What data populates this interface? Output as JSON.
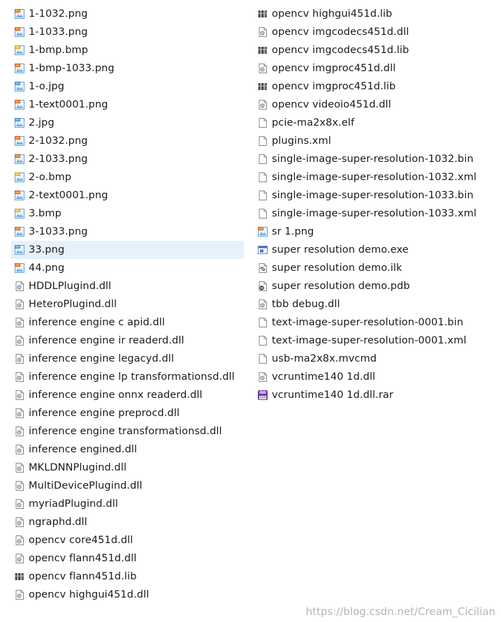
{
  "columns": [
    {
      "items": [
        {
          "name": "1-1032.png",
          "icon": "png-file-icon"
        },
        {
          "name": "1-1033.png",
          "icon": "png-file-icon"
        },
        {
          "name": "1-bmp.bmp",
          "icon": "bmp-file-icon"
        },
        {
          "name": "1-bmp-1033.png",
          "icon": "png-file-icon"
        },
        {
          "name": "1-o.jpg",
          "icon": "jpg-file-icon"
        },
        {
          "name": "1-text0001.png",
          "icon": "png-file-icon"
        },
        {
          "name": "2.jpg",
          "icon": "jpg-file-icon"
        },
        {
          "name": "2-1032.png",
          "icon": "png-file-icon"
        },
        {
          "name": "2-1033.png",
          "icon": "png-file-icon"
        },
        {
          "name": "2-o.bmp",
          "icon": "bmp-file-icon"
        },
        {
          "name": "2-text0001.png",
          "icon": "png-file-icon"
        },
        {
          "name": "3.bmp",
          "icon": "bmp-file-icon"
        },
        {
          "name": "3-1033.png",
          "icon": "png-file-icon"
        },
        {
          "name": "33.png",
          "icon": "jpg-file-icon",
          "selected": true
        },
        {
          "name": "44.png",
          "icon": "png-file-icon"
        },
        {
          "name": "HDDLPlugind.dll",
          "icon": "dll-file-icon"
        },
        {
          "name": "HeteroPlugind.dll",
          "icon": "dll-file-icon"
        },
        {
          "name": "inference engine c apid.dll",
          "icon": "dll-file-icon"
        },
        {
          "name": "inference engine ir readerd.dll",
          "icon": "dll-file-icon"
        },
        {
          "name": "inference engine legacyd.dll",
          "icon": "dll-file-icon"
        },
        {
          "name": "inference engine lp transformationsd.dll",
          "icon": "dll-file-icon"
        },
        {
          "name": "inference engine onnx readerd.dll",
          "icon": "dll-file-icon"
        },
        {
          "name": "inference engine preprocd.dll",
          "icon": "dll-file-icon"
        },
        {
          "name": "inference engine transformationsd.dll",
          "icon": "dll-file-icon"
        },
        {
          "name": "inference engined.dll",
          "icon": "dll-file-icon"
        },
        {
          "name": "MKLDNNPlugind.dll",
          "icon": "dll-file-icon"
        },
        {
          "name": "MultiDevicePlugind.dll",
          "icon": "dll-file-icon"
        },
        {
          "name": "myriadPlugind.dll",
          "icon": "dll-file-icon"
        },
        {
          "name": "ngraphd.dll",
          "icon": "dll-file-icon"
        },
        {
          "name": "opencv core451d.dll",
          "icon": "dll-file-icon"
        },
        {
          "name": "opencv flann451d.dll",
          "icon": "dll-file-icon"
        },
        {
          "name": "opencv flann451d.lib",
          "icon": "lib-file-icon"
        },
        {
          "name": "opencv highgui451d.dll",
          "icon": "dll-file-icon"
        }
      ]
    },
    {
      "items": [
        {
          "name": "opencv highgui451d.lib",
          "icon": "lib-file-icon"
        },
        {
          "name": "opencv imgcodecs451d.dll",
          "icon": "dll-file-icon"
        },
        {
          "name": "opencv imgcodecs451d.lib",
          "icon": "lib-file-icon"
        },
        {
          "name": "opencv imgproc451d.dll",
          "icon": "dll-file-icon"
        },
        {
          "name": "opencv imgproc451d.lib",
          "icon": "lib-file-icon"
        },
        {
          "name": "opencv videoio451d.dll",
          "icon": "dll-file-icon"
        },
        {
          "name": "pcie-ma2x8x.elf",
          "icon": "generic-file-icon"
        },
        {
          "name": "plugins.xml",
          "icon": "generic-file-icon"
        },
        {
          "name": "single-image-super-resolution-1032.bin",
          "icon": "generic-file-icon"
        },
        {
          "name": "single-image-super-resolution-1032.xml",
          "icon": "generic-file-icon"
        },
        {
          "name": "single-image-super-resolution-1033.bin",
          "icon": "generic-file-icon"
        },
        {
          "name": "single-image-super-resolution-1033.xml",
          "icon": "generic-file-icon"
        },
        {
          "name": "sr 1.png",
          "icon": "png-file-icon"
        },
        {
          "name": "super resolution demo.exe",
          "icon": "exe-file-icon"
        },
        {
          "name": "super resolution demo.ilk",
          "icon": "ilk-file-icon"
        },
        {
          "name": "super resolution demo.pdb",
          "icon": "pdb-file-icon"
        },
        {
          "name": "tbb debug.dll",
          "icon": "dll-file-icon"
        },
        {
          "name": "text-image-super-resolution-0001.bin",
          "icon": "generic-file-icon"
        },
        {
          "name": "text-image-super-resolution-0001.xml",
          "icon": "generic-file-icon"
        },
        {
          "name": "usb-ma2x8x.mvcmd",
          "icon": "generic-file-icon"
        },
        {
          "name": "vcruntime140 1d.dll",
          "icon": "dll-file-icon"
        },
        {
          "name": "vcruntime140 1d.dll.rar",
          "icon": "rar-file-icon"
        }
      ]
    }
  ],
  "watermark": "https://blog.csdn.net/Cream_Cicilian"
}
